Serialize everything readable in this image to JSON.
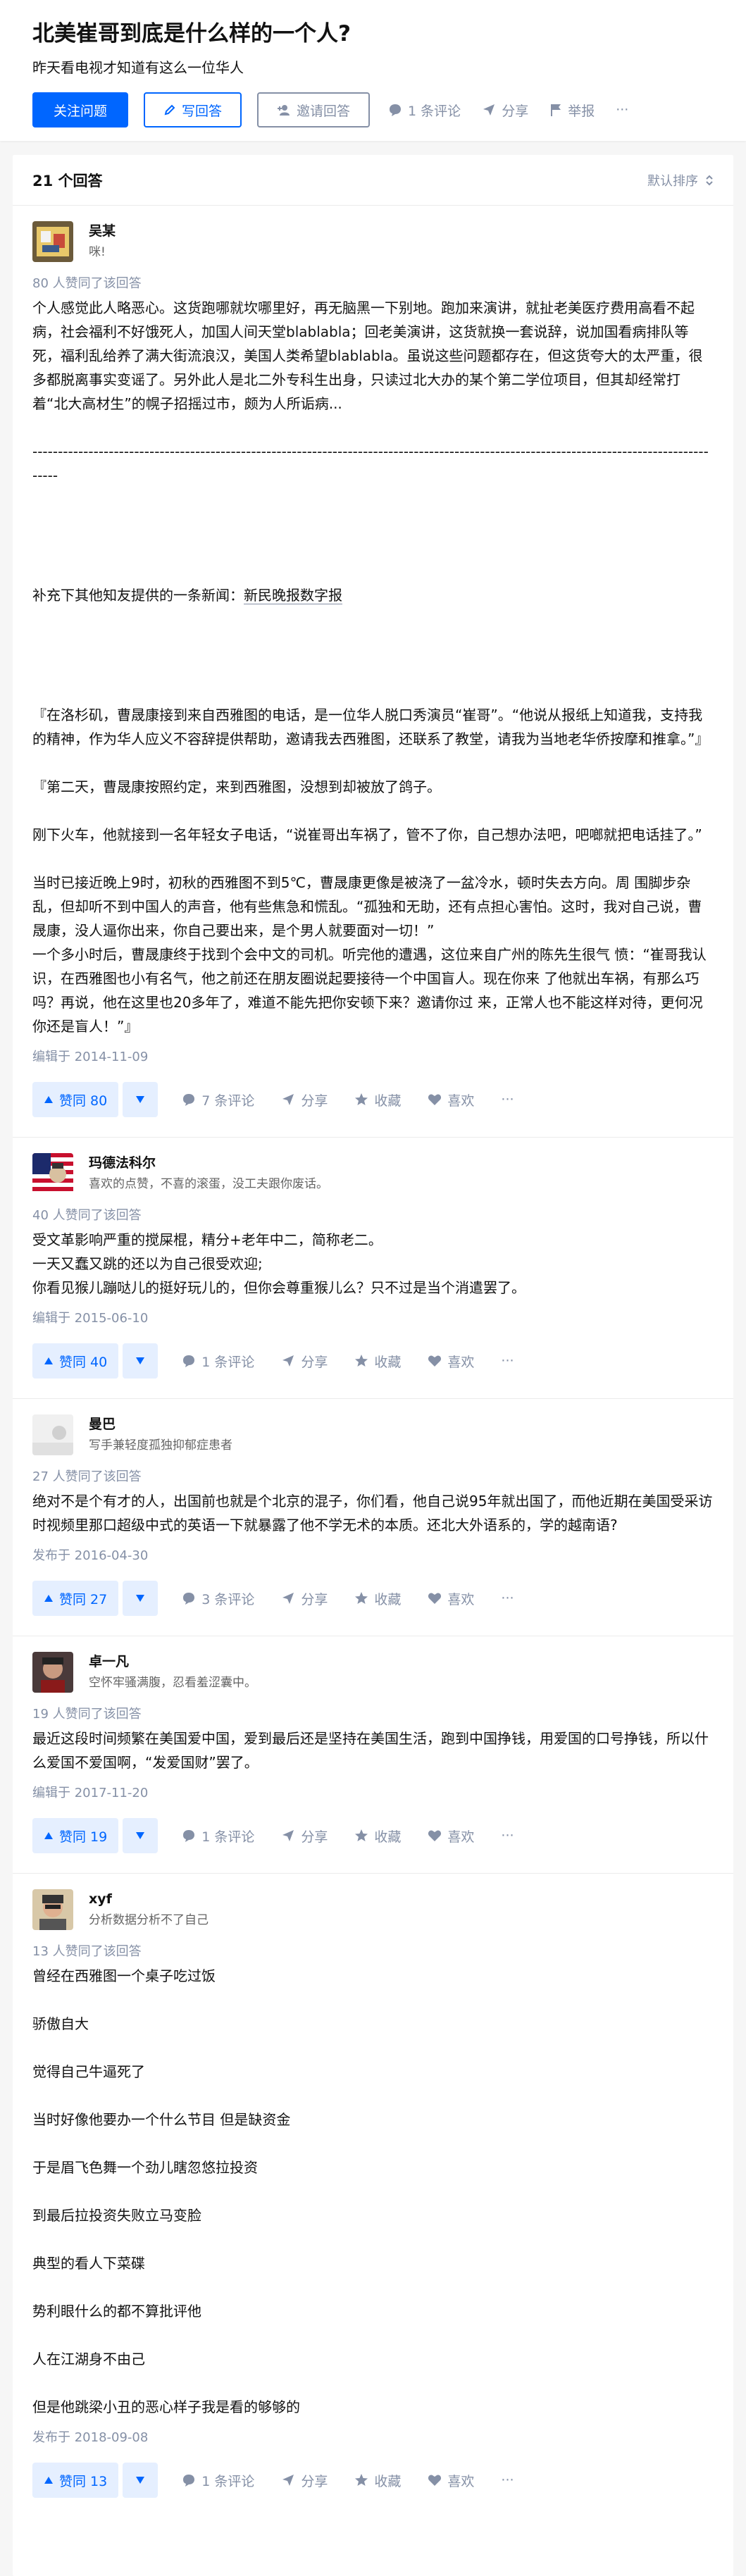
{
  "question": {
    "title": "北美崔哥到底是什么样的一个人?",
    "description": "昨天看电视才知道有这么一位华人",
    "follow_label": "关注问题",
    "write_label": "写回答",
    "invite_label": "邀请回答",
    "comments_label": "1 条评论",
    "share_label": "分享",
    "report_label": "举报",
    "more_label": "···"
  },
  "answers_header": {
    "count_label": "21 个回答",
    "sort_label": "默认排序"
  },
  "answers": [
    {
      "author": "吴某",
      "bio": "咪!",
      "votes_text": "80 人赞同了该回答",
      "paragraphs": [
        "个人感觉此人略恶心。这货跑哪就坎哪里好，再无脑黑一下别地。跑加来演讲，就扯老美医疗费用高看不起病，社会福利不好饿死人，加国人间天堂blablabla；回老美演讲，这货就换一套说辞，说加国看病排队等死，福利乱给养了满大街流浪汉，美国人类希望blablabla。虽说这些问题都存在，但这货夸大的太严重，很多都脱离事实变谣了。另外此人是北二外专科生出身，只读过北大办的某个第二学位项目，但其却经常打着“北大高材生”的幌子招摇过市，颇为人所诟病...",
        "------------------------------------------------------------------------------------------------------------------------------------------",
        "补充下其他知友提供的一条新闻：",
        "新民晚报数字报",
        "『在洛杉矶，曹晟康接到来自西雅图的电话，是一位华人脱口秀演员“崔哥”。“他说从报纸上知道我，支持我的精神，作为华人应义不容辞提供帮助，邀请我去西雅图，还联系了教堂，请我为当地老华侨按摩和推拿。”』",
        "『第二天，曹晟康按照约定，来到西雅图，没想到却被放了鸽子。",
        "刚下火车，他就接到一名年轻女子电话，“说崔哥出车祸了，管不了你，自己想办法吧，吧啷就把电话挂了。”",
        "当时已接近晚上9时，初秋的西雅图不到5℃，曹晟康更像是被浇了一盆冷水，顿时失去方向。周 围脚步杂乱，但却听不到中国人的声音，他有些焦急和慌乱。“孤独和无助，还有点担心害怕。这时，我对自己说，曹晟康，没人逼你出来，你自己要出来，是个男人就要面对一切！”",
        "一个多小时后，曹晟康终于找到个会中文的司机。听完他的遭遇，这位来自广州的陈先生很气 愤：“崔哥我认识，在西雅图也小有名气，他之前还在朋友圈说起要接待一个中国盲人。现在你来 了他就出车祸，有那么巧吗？再说，他在这里也20多年了，难道不能先把你安顿下来？邀请你过 来，正常人也不能这样对待，更何况你还是盲人！”』"
      ],
      "time": "编辑于 2014-11-09",
      "vote_label": "赞同 80",
      "comments": "7 条评论",
      "share": "分享",
      "collect": "收藏",
      "like": "喜欢",
      "more": "···"
    },
    {
      "author": "玛德法科尔",
      "bio": "喜欢的点赞，不喜的滚蛋，没工夫跟你废话。",
      "votes_text": "40 人赞同了该回答",
      "paragraphs": [
        "受文革影响严重的搅屎棍，精分+老年中二，简称老二。",
        "一天又蠢又跳的还以为自己很受欢迎;",
        "你看见猴儿蹦哒儿的挺好玩儿的，但你会尊重猴儿么？只不过是当个消遣罢了。"
      ],
      "time": "编辑于 2015-06-10",
      "vote_label": "赞同 40",
      "comments": "1 条评论",
      "share": "分享",
      "collect": "收藏",
      "like": "喜欢",
      "more": "···"
    },
    {
      "author": "曼巴",
      "bio": "写手兼轻度孤独抑郁症患者",
      "votes_text": "27 人赞同了该回答",
      "paragraphs": [
        "绝对不是个有才的人，出国前也就是个北京的混子，你们看，他自己说95年就出国了，而他近期在美国受采访时视频里那口超级中式的英语一下就暴露了他不学无术的本质。还北大外语系的，学的越南语?"
      ],
      "time": "发布于 2016-04-30",
      "vote_label": "赞同 27",
      "comments": "3 条评论",
      "share": "分享",
      "collect": "收藏",
      "like": "喜欢",
      "more": "···"
    },
    {
      "author": "卓一凡",
      "bio": "空怀牢骚满腹，忍看羞涩囊中。",
      "votes_text": "19 人赞同了该回答",
      "paragraphs": [
        "最近这段时间频繁在美国爱中国，爱到最后还是坚持在美国生活，跑到中国挣钱，用爱国的口号挣钱，所以什么爱国不爱国啊，“发爱国财”罢了。"
      ],
      "time": "编辑于 2017-11-20",
      "vote_label": "赞同 19",
      "comments": "1 条评论",
      "share": "分享",
      "collect": "收藏",
      "like": "喜欢",
      "more": "···"
    },
    {
      "author": "xyf",
      "bio": "分析数据分析不了自己",
      "votes_text": "13 人赞同了该回答",
      "paragraphs": [
        "曾经在西雅图一个桌子吃过饭",
        "骄傲自大",
        "觉得自己牛逼死了",
        "当时好像他要办一个什么节目 但是缺资金",
        "于是眉飞色舞一个劲儿瞎忽悠拉投资",
        "到最后拉投资失败立马变脸",
        "典型的看人下菜碟",
        "势利眼什么的都不算批评他",
        "人在江湖身不由己",
        "但是他跳梁小丑的恶心样子我是看的够够的"
      ],
      "time": "发布于 2018-09-08",
      "vote_label": "赞同 13",
      "comments": "1 条评论",
      "share": "分享",
      "collect": "收藏",
      "like": "喜欢",
      "more": "···"
    }
  ],
  "colors": {
    "brand_blue": "#0066ff",
    "vote_bg": "#e5efff",
    "meta_gray": "#8590a6"
  }
}
